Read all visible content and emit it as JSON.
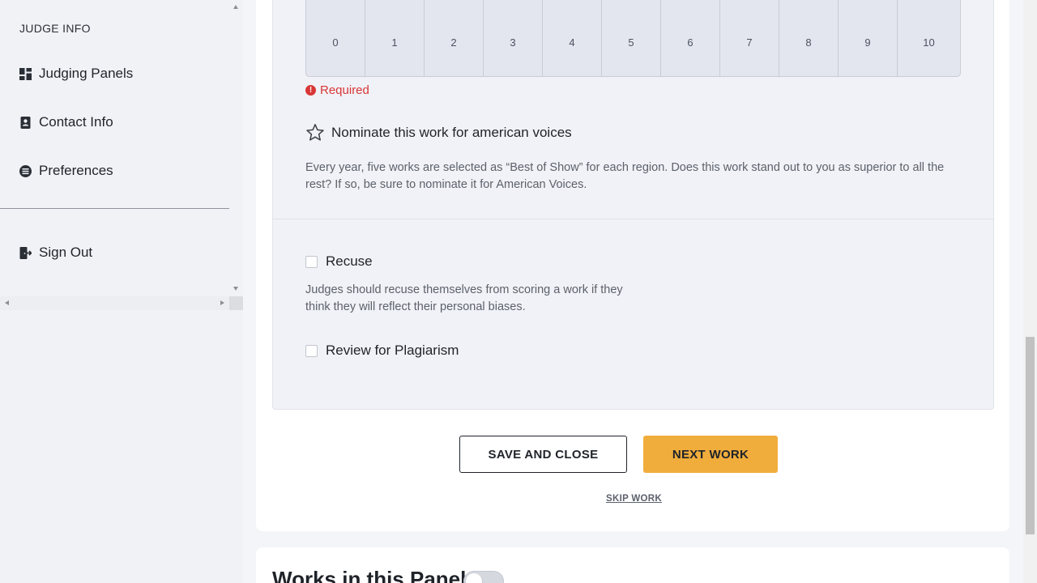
{
  "sidebar": {
    "section_title": "JUDGE INFO",
    "items": [
      {
        "label": "Judging Panels",
        "icon": "dashboard-icon"
      },
      {
        "label": "Contact Info",
        "icon": "contact-book-icon"
      },
      {
        "label": "Preferences",
        "icon": "preferences-icon"
      }
    ],
    "sign_out": {
      "label": "Sign Out",
      "icon": "sign-out-icon"
    }
  },
  "scoring": {
    "scores": [
      "0",
      "1",
      "2",
      "3",
      "4",
      "5",
      "6",
      "7",
      "8",
      "9",
      "10"
    ],
    "required_text": "Required"
  },
  "nominate": {
    "label": "Nominate this work for american voices",
    "description": "Every year, five works are selected as “Best of Show” for each region. Does this work stand out to you as superior to all the rest? If so, be sure to nominate it for American Voices."
  },
  "recuse": {
    "label": "Recuse",
    "description": "Judges should recuse themselves from scoring a work if they think they will reflect their personal biases.",
    "checked": false
  },
  "plagiarism": {
    "label": "Review for Plagiarism",
    "checked": false
  },
  "actions": {
    "save_close": "SAVE AND CLOSE",
    "next_work": "NEXT WORK",
    "skip_work": "SKIP WORK"
  },
  "works_panel": {
    "title": "Works in this Panel",
    "toggle_on": false
  },
  "colors": {
    "accent": "#f1ad3c",
    "error": "#d93636"
  }
}
